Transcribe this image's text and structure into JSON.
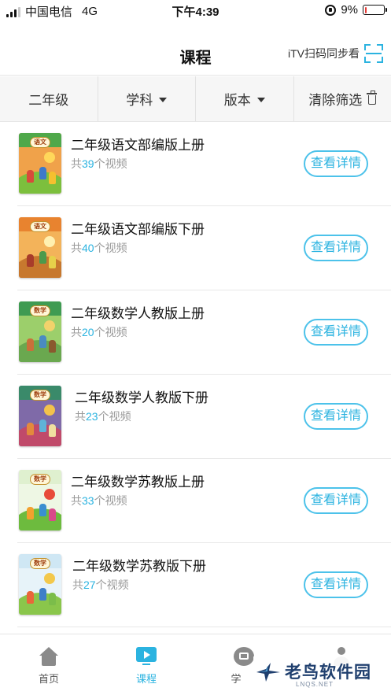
{
  "status_bar": {
    "carrier": "中国电信",
    "network": "4G",
    "time": "下午4:39",
    "battery": "9%",
    "battery_level": 0.09
  },
  "nav": {
    "title": "课程",
    "scan_label": "iTV扫码同步看"
  },
  "filters": {
    "grade": "二年级",
    "subject": "学科",
    "edition": "版本",
    "clear": "清除筛选"
  },
  "courses": [
    {
      "title": "二年级语文部编版上册",
      "count_prefix": "共",
      "count": "39",
      "count_suffix": "个视频",
      "button": "查看详情",
      "cover_tag": "语文",
      "palette": {
        "band": "#4fa84a",
        "bg": "#f0a24a",
        "hill": "#7cbf3d",
        "sun": "#ffd75a",
        "kids": [
          "#d84b3b",
          "#3e79c9",
          "#f5c02f"
        ]
      }
    },
    {
      "title": "二年级语文部编版下册",
      "count_prefix": "共",
      "count": "40",
      "count_suffix": "个视频",
      "button": "查看详情",
      "cover_tag": "语文",
      "palette": {
        "band": "#e8832f",
        "bg": "#f3b35a",
        "hill": "#c7782e",
        "sun": "#fff0b0",
        "kids": [
          "#a83c2a",
          "#4b9a4c",
          "#e6d04a"
        ]
      }
    },
    {
      "title": "二年级数学人教版上册",
      "count_prefix": "共",
      "count": "20",
      "count_suffix": "个视频",
      "button": "查看详情",
      "cover_tag": "数学",
      "palette": {
        "band": "#3f9b52",
        "bg": "#9ccf6b",
        "hill": "#6aa84f",
        "sun": "#f2d26b",
        "kids": [
          "#c9703a",
          "#4a8bc1",
          "#8a5a2e"
        ]
      }
    },
    {
      "title": "二年级数学人教版下册",
      "count_prefix": "共",
      "count": "23",
      "count_suffix": "个视频",
      "button": "查看详情",
      "cover_tag": "数学",
      "palette": {
        "band": "#3a8a6a",
        "bg": "#7f6aa8",
        "hill": "#c04a6a",
        "sun": "#f3c24b",
        "kids": [
          "#e38a3c",
          "#5fb3d8",
          "#f0e0a0"
        ]
      }
    },
    {
      "title": "二年级数学苏教版上册",
      "count_prefix": "共",
      "count": "33",
      "count_suffix": "个视频",
      "button": "查看详情",
      "cover_tag": "数学",
      "palette": {
        "band": "#dff0cf",
        "bg": "#eef7e4",
        "hill": "#6dbb3e",
        "sun": "#e84b3a",
        "kids": [
          "#f2a12e",
          "#3a8fd0",
          "#d94a8a"
        ]
      }
    },
    {
      "title": "二年级数学苏教版下册",
      "count_prefix": "共",
      "count": "27",
      "count_suffix": "个视频",
      "button": "查看详情",
      "cover_tag": "数学",
      "palette": {
        "band": "#cfe7f4",
        "bg": "#e7f3f9",
        "hill": "#8ac64b",
        "sun": "#f3c84b",
        "kids": [
          "#e8673a",
          "#3f7fc8",
          "#7bbd4a"
        ]
      }
    }
  ],
  "tabs": [
    {
      "label": "首页",
      "icon": "home-icon",
      "active": false
    },
    {
      "label": "课程",
      "icon": "video-icon",
      "active": true
    },
    {
      "label": "学",
      "icon": "study-icon",
      "active": false
    },
    {
      "label": "",
      "icon": "user-icon",
      "active": false
    }
  ],
  "watermark": {
    "text": "老鸟软件园",
    "sub": "LNQS.NET"
  },
  "colors": {
    "accent": "#2bb3e0",
    "battery_low": "#e53935"
  }
}
